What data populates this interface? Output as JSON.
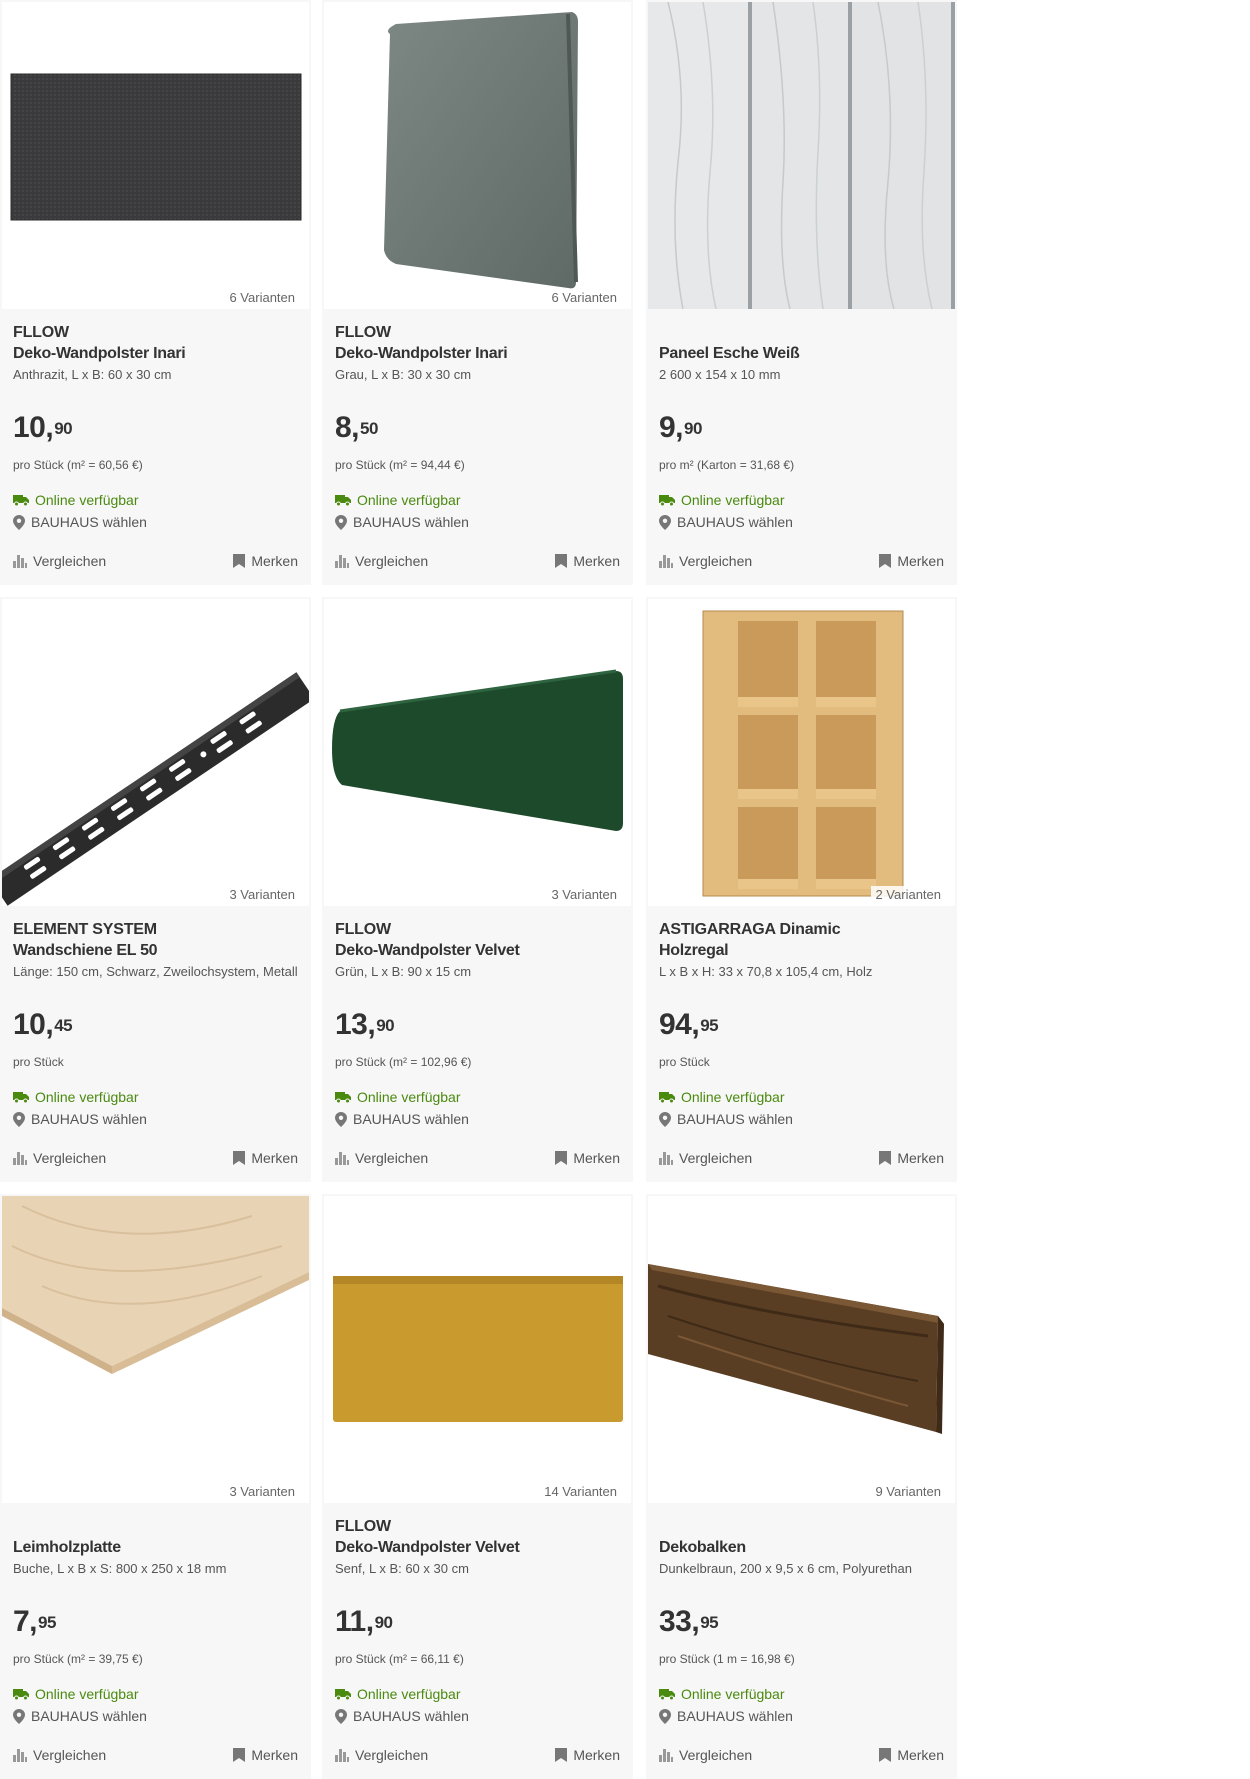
{
  "products": [
    {
      "brand": "FLLOW",
      "name": "Deko-Wandpolster Inari",
      "desc": "Anthrazit, L x B: 60 x 30 cm",
      "price_main": "10,",
      "price_cents": "90",
      "unit": "pro Stück (m² = 60,56 €)",
      "variants": "6 Varianten",
      "availability": "Online verfügbar",
      "store": "BAUHAUS wählen",
      "compare": "Vergleichen",
      "remember": "Merken"
    },
    {
      "brand": "FLLOW",
      "name": "Deko-Wandpolster Inari",
      "desc": "Grau, L x B: 30 x 30 cm",
      "price_main": "8,",
      "price_cents": "50",
      "unit": "pro Stück (m² = 94,44 €)",
      "variants": "6 Varianten",
      "availability": "Online verfügbar",
      "store": "BAUHAUS wählen",
      "compare": "Vergleichen",
      "remember": "Merken"
    },
    {
      "brand": "",
      "name": "Paneel Esche Weiß",
      "desc": "2 600 x 154 x 10 mm",
      "price_main": "9,",
      "price_cents": "90",
      "unit": "pro m² (Karton = 31,68 €)",
      "variants": "",
      "availability": "Online verfügbar",
      "store": "BAUHAUS wählen",
      "compare": "Vergleichen",
      "remember": "Merken"
    },
    {
      "brand": "ELEMENT SYSTEM",
      "name": "Wandschiene EL 50",
      "desc": "Länge: 150 cm, Schwarz, Zweilochsystem, Metall",
      "price_main": "10,",
      "price_cents": "45",
      "unit": "pro Stück",
      "variants": "3 Varianten",
      "availability": "Online verfügbar",
      "store": "BAUHAUS wählen",
      "compare": "Vergleichen",
      "remember": "Merken"
    },
    {
      "brand": "FLLOW",
      "name": "Deko-Wandpolster Velvet",
      "desc": "Grün, L x B: 90 x 15 cm",
      "price_main": "13,",
      "price_cents": "90",
      "unit": "pro Stück (m² = 102,96 €)",
      "variants": "3 Varianten",
      "availability": "Online verfügbar",
      "store": "BAUHAUS wählen",
      "compare": "Vergleichen",
      "remember": "Merken"
    },
    {
      "brand": "ASTIGARRAGA Dinamic",
      "name": "Holzregal",
      "desc": "L x B x H: 33 x 70,8 x 105,4 cm, Holz",
      "price_main": "94,",
      "price_cents": "95",
      "unit": "pro Stück",
      "variants": "2 Varianten",
      "availability": "Online verfügbar",
      "store": "BAUHAUS wählen",
      "compare": "Vergleichen",
      "remember": "Merken"
    },
    {
      "brand": "",
      "name": "Leimholzplatte",
      "desc": "Buche, L x B x S: 800 x 250 x 18 mm",
      "price_main": "7,",
      "price_cents": "95",
      "unit": "pro Stück (m² = 39,75 €)",
      "variants": "3 Varianten",
      "availability": "Online verfügbar",
      "store": "BAUHAUS wählen",
      "compare": "Vergleichen",
      "remember": "Merken"
    },
    {
      "brand": "FLLOW",
      "name": "Deko-Wandpolster Velvet",
      "desc": "Senf, L x B: 60 x 30 cm",
      "price_main": "11,",
      "price_cents": "90",
      "unit": "pro Stück (m² = 66,11 €)",
      "variants": "14 Varianten",
      "availability": "Online verfügbar",
      "store": "BAUHAUS wählen",
      "compare": "Vergleichen",
      "remember": "Merken"
    },
    {
      "brand": "",
      "name": "Dekobalken",
      "desc": "Dunkelbraun, 200 x 9,5 x 6 cm, Polyurethan",
      "price_main": "33,",
      "price_cents": "95",
      "unit": "pro Stück (1 m = 16,98 €)",
      "variants": "9 Varianten",
      "availability": "Online verfügbar",
      "store": "BAUHAUS wählen",
      "compare": "Vergleichen",
      "remember": "Merken"
    }
  ],
  "colors": {
    "card_bg": "#f7f7f7",
    "available_green": "#4a8a0f",
    "text_dark": "#333333"
  },
  "icons": {
    "availability": "truck-icon",
    "store": "location-pin-icon",
    "compare": "bar-chart-icon",
    "remember": "bookmark-icon"
  }
}
